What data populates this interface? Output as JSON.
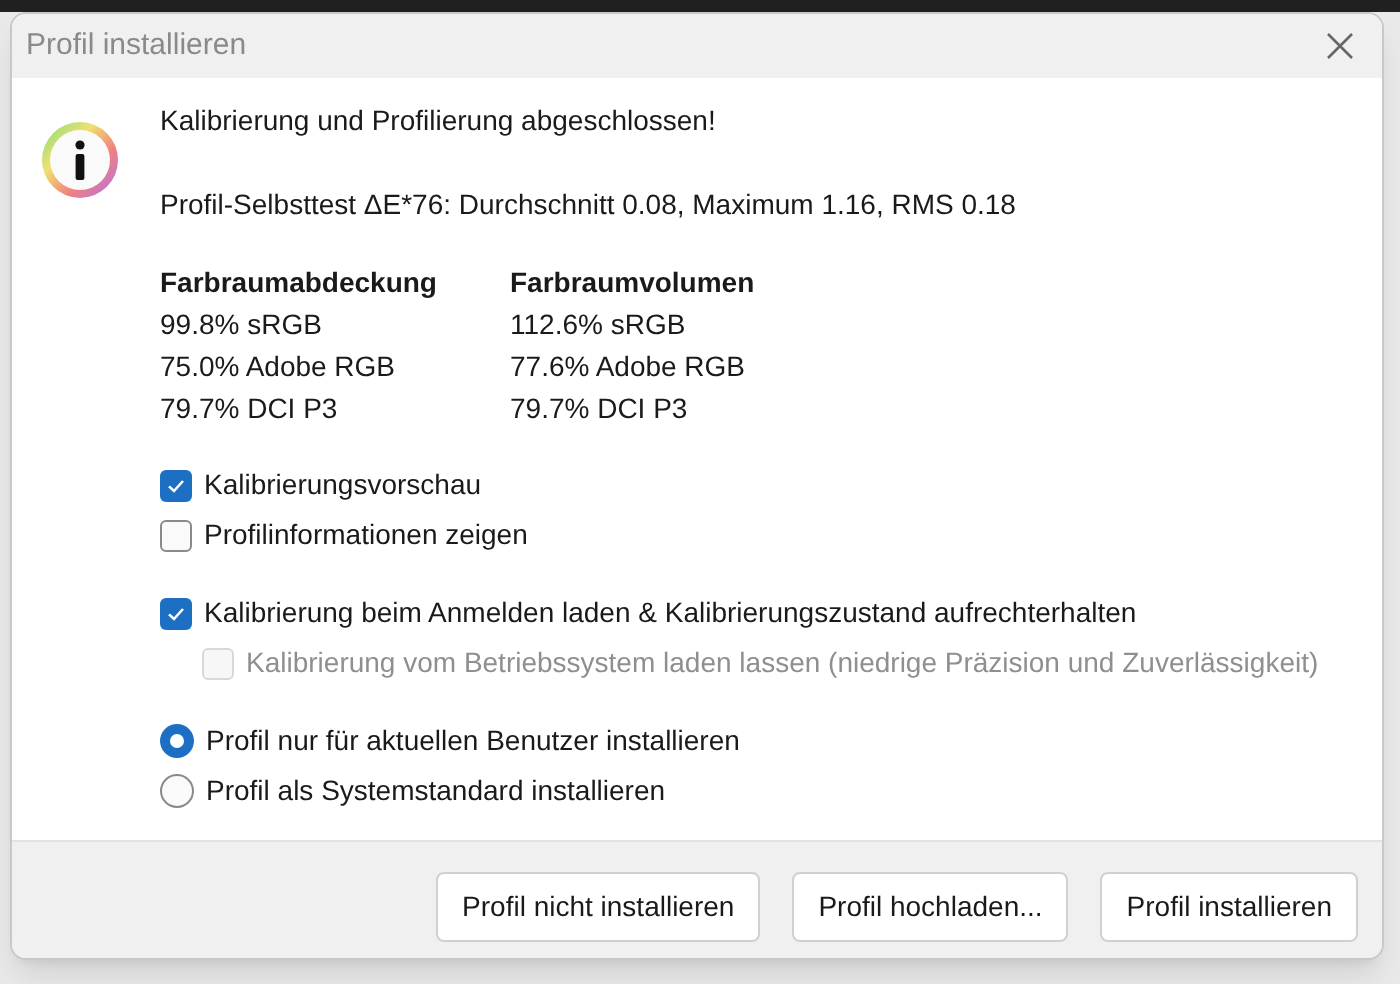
{
  "window": {
    "title": "Profil installieren"
  },
  "heading": "Kalibrierung und Profilierung abgeschlossen!",
  "self_test": "Profil-Selbsttest ΔE*76: Durchschnitt 0.08, Maximum 1.16, RMS 0.18",
  "gamut_columns": [
    {
      "title": "Farbraumabdeckung",
      "values": [
        "99.8% sRGB",
        "75.0% Adobe RGB",
        "79.7% DCI P3"
      ]
    },
    {
      "title": "Farbraumvolumen",
      "values": [
        "112.6% sRGB",
        "77.6% Adobe RGB",
        "79.7% DCI P3"
      ]
    }
  ],
  "option_groups": [
    [
      {
        "kind": "checkbox",
        "label": "Kalibrierungsvorschau",
        "checked": true,
        "disabled": false
      },
      {
        "kind": "checkbox",
        "label": "Profilinformationen zeigen",
        "checked": false,
        "disabled": false
      }
    ],
    [
      {
        "kind": "checkbox",
        "label": "Kalibrierung beim Anmelden laden & Kalibrierungszustand aufrechterhalten",
        "checked": true,
        "disabled": false,
        "children": [
          {
            "kind": "checkbox",
            "label": "Kalibrierung vom Betriebssystem laden lassen (niedrige Präzision und Zuverlässigkeit)",
            "checked": false,
            "disabled": true
          }
        ]
      }
    ],
    [
      {
        "kind": "radio",
        "label": "Profil nur für aktuellen Benutzer installieren",
        "selected": true
      },
      {
        "kind": "radio",
        "label": "Profil als Systemstandard installieren",
        "selected": false
      }
    ]
  ],
  "buttons": [
    "Profil nicht installieren",
    "Profil hochladen...",
    "Profil installieren"
  ]
}
